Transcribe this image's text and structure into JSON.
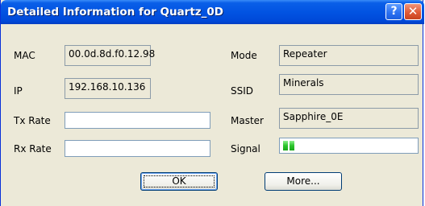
{
  "window": {
    "title": "Detailed Information for Quartz_0D",
    "help_label": "?",
    "close_label": "✕"
  },
  "left": {
    "mac_label": "MAC",
    "mac_value": "00.0d.8d.f0.12.98",
    "ip_label": "IP",
    "ip_value": "192.168.10.136",
    "tx_label": "Tx Rate",
    "tx_value": "",
    "rx_label": "Rx Rate",
    "rx_value": ""
  },
  "right": {
    "mode_label": "Mode",
    "mode_value": "Repeater",
    "ssid_label": "SSID",
    "ssid_value": "Minerals",
    "master_label": "Master",
    "master_value": "Sapphire_0E",
    "signal_label": "Signal",
    "signal_level": 0.08
  },
  "buttons": {
    "ok_label": "OK",
    "more_label": "More..."
  },
  "colors": {
    "titlebar": "#0254e2",
    "dialog_bg": "#ece9d8",
    "signal_green": "#2bc42b"
  }
}
